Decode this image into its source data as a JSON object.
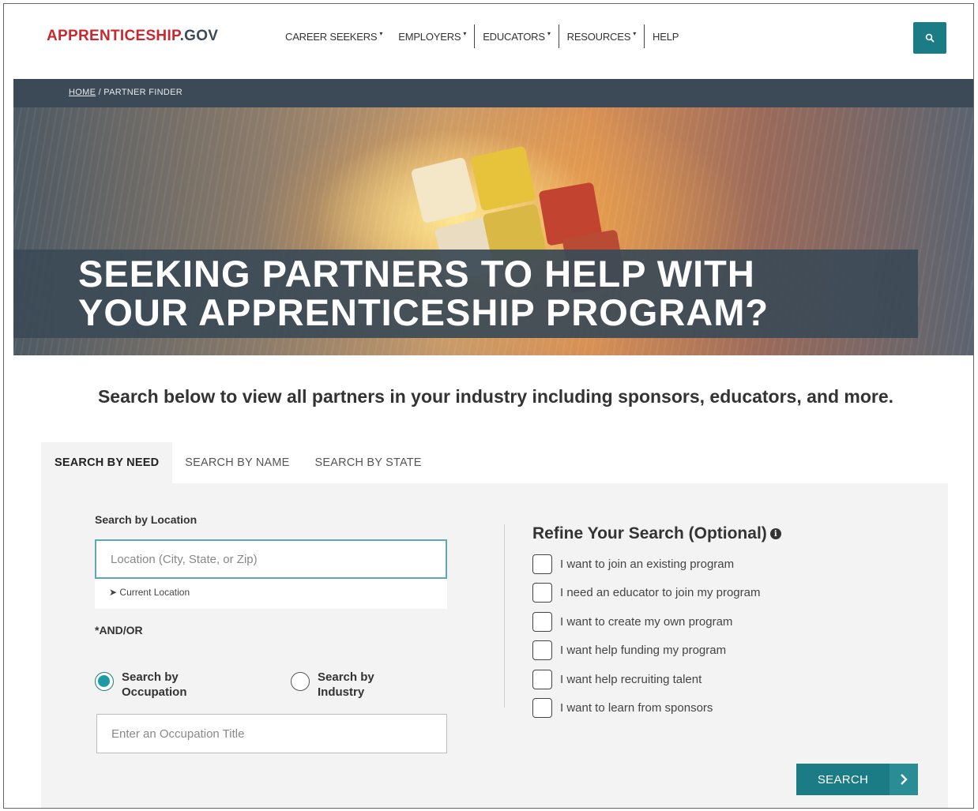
{
  "brand": {
    "logo_primary": "APPRENTICESHIP",
    "logo_suffix": ".GOV",
    "colors": {
      "red": "#c8282e",
      "teal": "#1c7c85",
      "slate": "#3b4a56"
    }
  },
  "nav": {
    "items": [
      {
        "label": "CAREER SEEKERS",
        "has_dropdown": true
      },
      {
        "label": "EMPLOYERS",
        "has_dropdown": true
      },
      {
        "label": "EDUCATORS",
        "has_dropdown": true
      },
      {
        "label": "RESOURCES",
        "has_dropdown": true
      },
      {
        "label": "HELP",
        "has_dropdown": false
      }
    ],
    "dropdown_glyph": "▾",
    "search_icon": "search-icon"
  },
  "breadcrumb": {
    "home": "HOME",
    "separator": "/",
    "current": "PARTNER FINDER"
  },
  "hero": {
    "line1": "SEEKING PARTNERS TO HELP WITH",
    "line2": "YOUR APPRENTICESHIP PROGRAM?"
  },
  "intro": "Search below to view all partners in your industry including sponsors, educators, and more.",
  "tabs": [
    {
      "label": "SEARCH BY NEED",
      "active": true
    },
    {
      "label": "SEARCH BY NAME",
      "active": false
    },
    {
      "label": "SEARCH BY STATE",
      "active": false
    }
  ],
  "form": {
    "location_label": "Search by Location",
    "location_placeholder": "Location (City, State, or Zip)",
    "current_location": "Current Location",
    "andor": "*AND/OR",
    "radio_occupation": "Search by Occupation",
    "radio_industry": "Search by Industry",
    "radio_selected": "occupation",
    "occupation_placeholder": "Enter an Occupation Title",
    "refine_title": "Refine Your Search (Optional)",
    "refine_options": [
      "I want to join an existing program",
      "I need an educator to join my program",
      "I want to create my own program",
      "I want help funding my program",
      "I want help recruiting talent",
      "I want to learn from sponsors"
    ],
    "submit_label": "SEARCH",
    "submit_icon": "chevron-right-icon"
  }
}
